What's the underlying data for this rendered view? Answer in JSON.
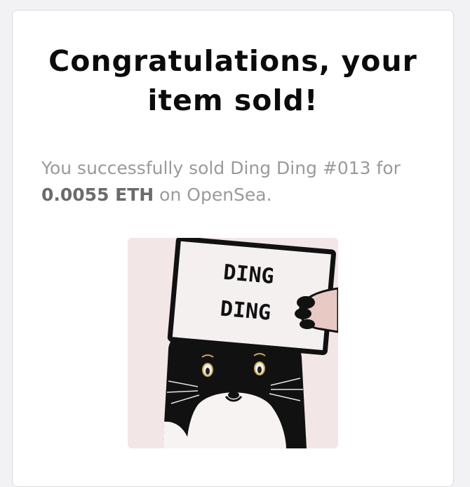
{
  "card": {
    "title": "Congratulations, your item sold!",
    "message_prefix": "You successfully sold Ding Ding #013 for ",
    "price": "0.0055 ETH",
    "message_suffix": " on OpenSea."
  },
  "nft": {
    "sign_line_1": "DING",
    "sign_line_2": "DING",
    "background_color": "#f2e6e6",
    "sign_color": "#f4f0f0",
    "cat_color": "#111111"
  }
}
